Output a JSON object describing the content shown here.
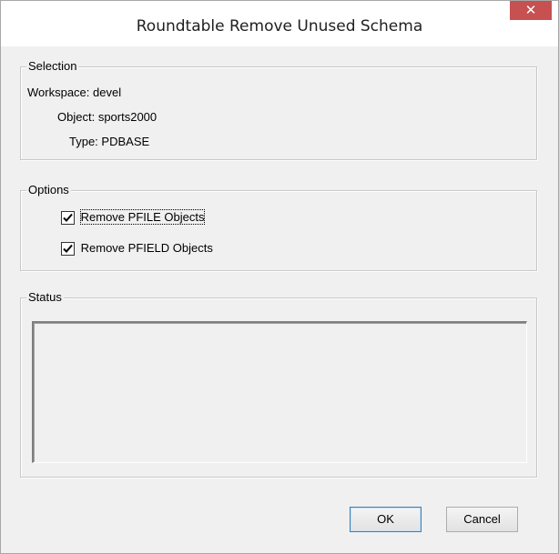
{
  "window": {
    "title": "Roundtable Remove Unused Schema",
    "close_glyph": "✕"
  },
  "selection": {
    "legend": "Selection",
    "workspace_label": "Workspace:",
    "workspace_value": "devel",
    "object_label": "Object:",
    "object_value": "sports2000",
    "type_label": "Type:",
    "type_value": "PDBASE"
  },
  "options": {
    "legend": "Options",
    "remove_pfile": {
      "label": "Remove PFILE Objects",
      "checked": true
    },
    "remove_pfield": {
      "label": "Remove PFIELD Objects",
      "checked": true
    }
  },
  "status": {
    "legend": "Status",
    "text": ""
  },
  "buttons": {
    "ok": "OK",
    "cancel": "Cancel"
  },
  "colors": {
    "close_button": "#c75050",
    "window_bg": "#f0f0f0",
    "titlebar_bg": "#ffffff"
  },
  "icons": {
    "close": "close-icon",
    "check": "checkmark-icon"
  }
}
